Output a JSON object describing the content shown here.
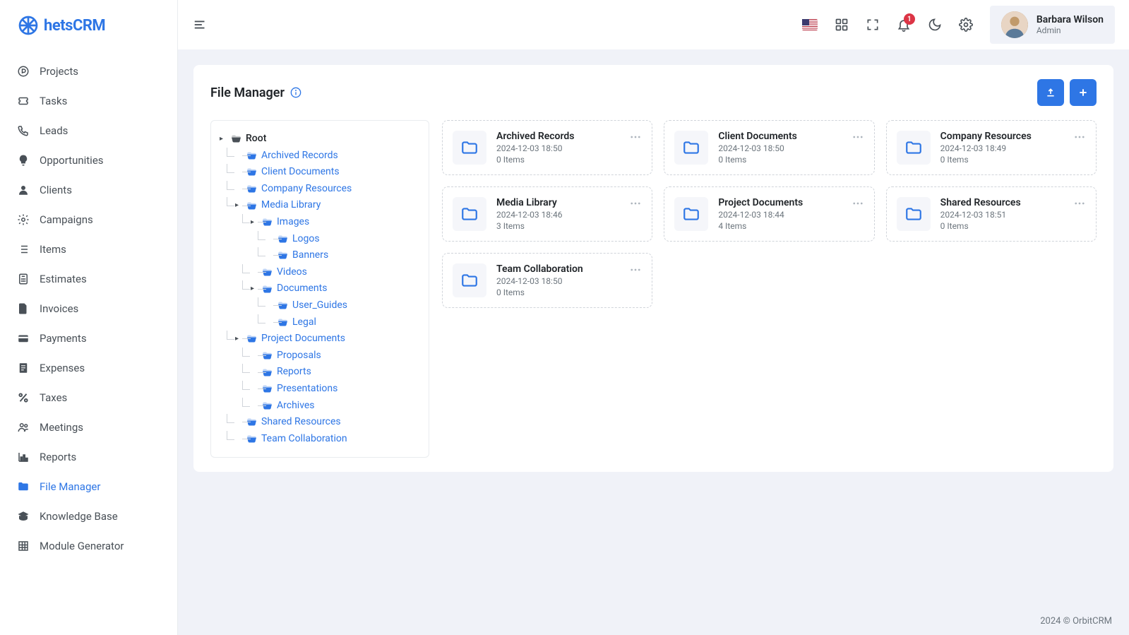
{
  "brand": {
    "name": "hetsCRM"
  },
  "header": {
    "notifications_count": "1",
    "user_name": "Barbara Wilson",
    "user_role": "Admin"
  },
  "sidebar": {
    "items": [
      {
        "label": "Projects",
        "icon": "p-circle"
      },
      {
        "label": "Tasks",
        "icon": "ticket"
      },
      {
        "label": "Leads",
        "icon": "phone"
      },
      {
        "label": "Opportunities",
        "icon": "bulb"
      },
      {
        "label": "Clients",
        "icon": "user"
      },
      {
        "label": "Campaigns",
        "icon": "gear"
      },
      {
        "label": "Items",
        "icon": "list"
      },
      {
        "label": "Estimates",
        "icon": "calculator"
      },
      {
        "label": "Invoices",
        "icon": "file"
      },
      {
        "label": "Payments",
        "icon": "card"
      },
      {
        "label": "Expenses",
        "icon": "receipt"
      },
      {
        "label": "Taxes",
        "icon": "percent"
      },
      {
        "label": "Meetings",
        "icon": "people"
      },
      {
        "label": "Reports",
        "icon": "chart"
      },
      {
        "label": "File Manager",
        "icon": "folder",
        "active": true
      },
      {
        "label": "Knowledge Base",
        "icon": "grad"
      },
      {
        "label": "Module Generator",
        "icon": "grid"
      }
    ]
  },
  "page": {
    "title": "File Manager"
  },
  "tree": [
    {
      "label": "Root",
      "root": true,
      "expanded": true,
      "children": [
        {
          "label": "Archived Records"
        },
        {
          "label": "Client Documents"
        },
        {
          "label": "Company Resources"
        },
        {
          "label": "Media Library",
          "expanded": true,
          "children": [
            {
              "label": "Images",
              "expanded": true,
              "children": [
                {
                  "label": "Logos"
                },
                {
                  "label": "Banners"
                }
              ]
            },
            {
              "label": "Videos"
            },
            {
              "label": "Documents",
              "expanded": true,
              "children": [
                {
                  "label": "User_Guides"
                },
                {
                  "label": "Legal"
                }
              ]
            }
          ]
        },
        {
          "label": "Project Documents",
          "expanded": true,
          "children": [
            {
              "label": "Proposals"
            },
            {
              "label": "Reports"
            },
            {
              "label": "Presentations"
            },
            {
              "label": "Archives"
            }
          ]
        },
        {
          "label": "Shared Resources"
        },
        {
          "label": "Team Collaboration"
        }
      ]
    }
  ],
  "folders": [
    {
      "name": "Archived Records",
      "date": "2024-12-03 18:50",
      "count": "0 Items"
    },
    {
      "name": "Client Documents",
      "date": "2024-12-03 18:50",
      "count": "0 Items"
    },
    {
      "name": "Company Resources",
      "date": "2024-12-03 18:49",
      "count": "0 Items"
    },
    {
      "name": "Media Library",
      "date": "2024-12-03 18:46",
      "count": "3 Items"
    },
    {
      "name": "Project Documents",
      "date": "2024-12-03 18:44",
      "count": "4 Items"
    },
    {
      "name": "Shared Resources",
      "date": "2024-12-03 18:51",
      "count": "0 Items"
    },
    {
      "name": "Team Collaboration",
      "date": "2024-12-03 18:50",
      "count": "0 Items"
    }
  ],
  "footer": {
    "text": "2024 © OrbitCRM"
  }
}
